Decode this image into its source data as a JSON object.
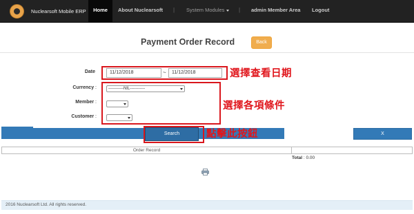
{
  "navbar": {
    "brand": "Nuclearsoft Mobile ERP",
    "items": [
      {
        "label": "Home"
      },
      {
        "label": "About Nuclearsoft"
      },
      {
        "label": "System Modules"
      },
      {
        "label": "admin Member Area"
      },
      {
        "label": "Logout"
      }
    ],
    "separator": "|"
  },
  "page": {
    "title": "Payment Order Record",
    "back_label": "Back"
  },
  "form": {
    "date_label": "Date",
    "date_from": "11/12/2018",
    "date_to": "11/12/2018",
    "date_separator": "~",
    "currency_label": "Currency",
    "currency_value": "-----------NIL-----------",
    "member_label": "Member",
    "member_value": "",
    "customer_label": "Customer",
    "customer_value": "",
    "colon": ":"
  },
  "annotations": {
    "date_note": "選擇查看日期",
    "conditions_note": "選擇各項條件",
    "button_note": "點擊此按鈕"
  },
  "actions": {
    "search_label": "Search",
    "close_label": "X"
  },
  "table": {
    "header": "Order Record",
    "total_label": "Total",
    "total_value": ": 0.00"
  },
  "footer": {
    "copyright": "2016 Nuclearsoft Ltd.  All rights reserved."
  },
  "colors": {
    "navbar": "#222222",
    "primary": "#337ab7",
    "warning": "#f0ad4e",
    "annotation_red": "#e0161c"
  }
}
